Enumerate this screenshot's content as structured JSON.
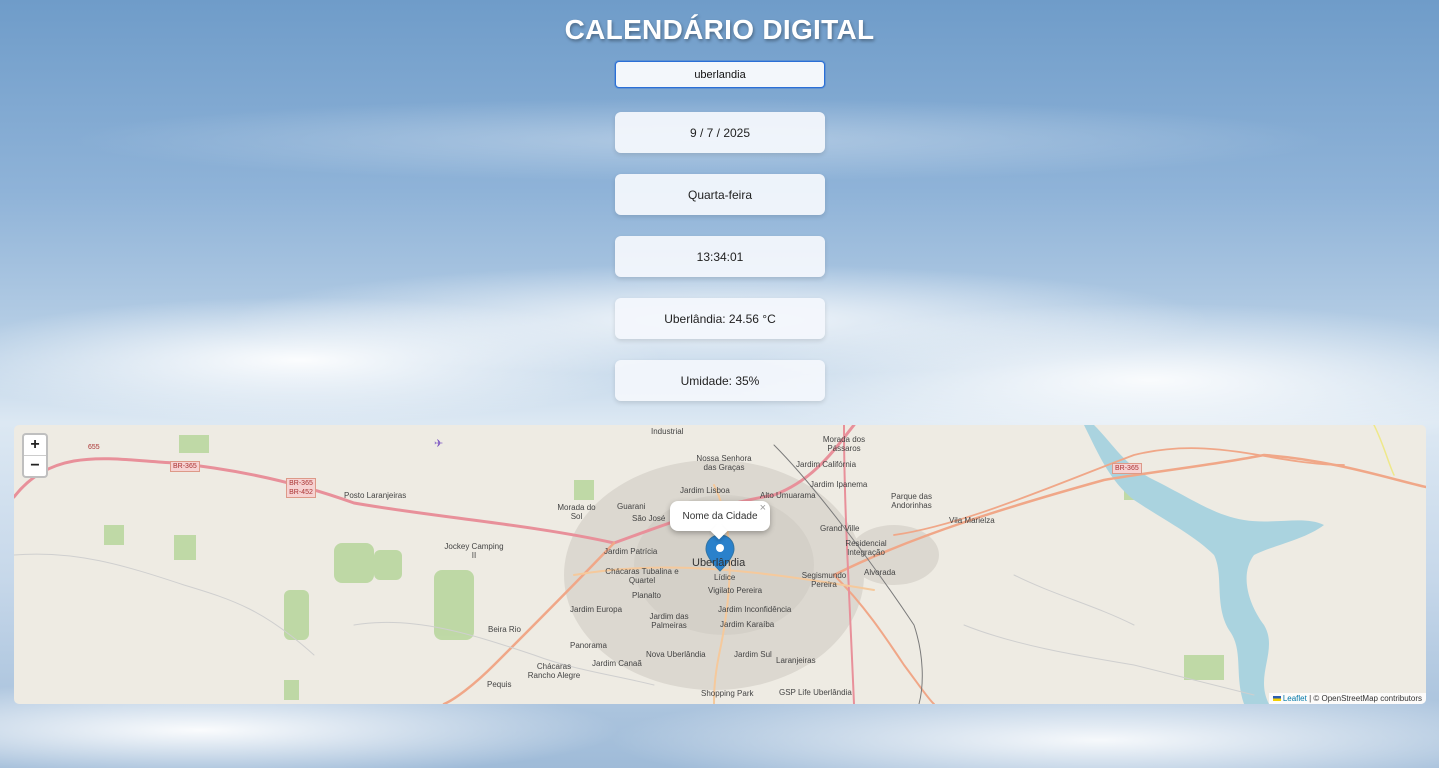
{
  "title": "CALENDÁRIO DIGITAL",
  "city_input": {
    "value": "uberlandia"
  },
  "cards": {
    "date": "9 / 7 / 2025",
    "weekday": "Quarta-feira",
    "time": "13:34:01",
    "temperature": "Uberlândia: 24.56 °C",
    "humidity": "Umidade: 35%"
  },
  "map": {
    "zoom_in": "+",
    "zoom_out": "−",
    "popup_text": "Nome da Cidade",
    "popup_close": "×",
    "attribution_link": "Leaflet",
    "attribution_text": " | © OpenStreetMap contributors",
    "labels": {
      "industrial": "Industrial",
      "nossa_senhora": "Nossa Senhora das Graças",
      "morada_passaros": "Morada dos Pássaros",
      "jardim_california": "Jardim Califórnia",
      "jardim_lisboa": "Jardim Lisboa",
      "alto_umuarama": "Alto Umuarama",
      "jardim_ipanema": "Jardim Ipanema",
      "parque_andorinhas": "Parque das Andorinhas",
      "posto_laranjeiras": "Posto Laranjeiras",
      "morada_sol": "Morada do Sol",
      "guarani": "Guarani",
      "sao_jose": "São José",
      "grand_ville": "Grand Ville",
      "vila_marielza": "Vila Marielza",
      "jockey": "Jockey Camping II",
      "jardim_patricia": "Jardim Patrícia",
      "residencial_integracao": "Residencial Integração",
      "uberlandia": "Uberlândia",
      "lidice": "Lídice",
      "chacaras_tubalina": "Chácaras Tubalina e Quartel",
      "segismundo": "Segismundo Pereira",
      "alvorada": "Alvorada",
      "vigilato": "Vigilato Pereira",
      "planalto": "Planalto",
      "jardim_europa": "Jardim Europa",
      "jardim_inconfidencia": "Jardim Inconfidência",
      "jardim_palmeiras": "Jardim das Palmeiras",
      "jardim_karaiba": "Jardim Karaíba",
      "beira_rio": "Beira Rio",
      "panorama": "Panorama",
      "jardim_sul": "Jardim Sul",
      "nova_uberlandia": "Nova Uberlândia",
      "laranjeiras": "Laranjeiras",
      "jardim_canaa": "Jardim Canaã",
      "chacaras_rancho": "Chácaras Rancho Alegre",
      "pequis": "Pequis",
      "shopping_park": "Shopping Park",
      "gsp_life": "GSP Life Uberlândia"
    },
    "shields": {
      "br365_west": "BR-365",
      "br365_452": "BR-365 BR-452",
      "br365_east": "BR-365",
      "r655": "655"
    }
  }
}
